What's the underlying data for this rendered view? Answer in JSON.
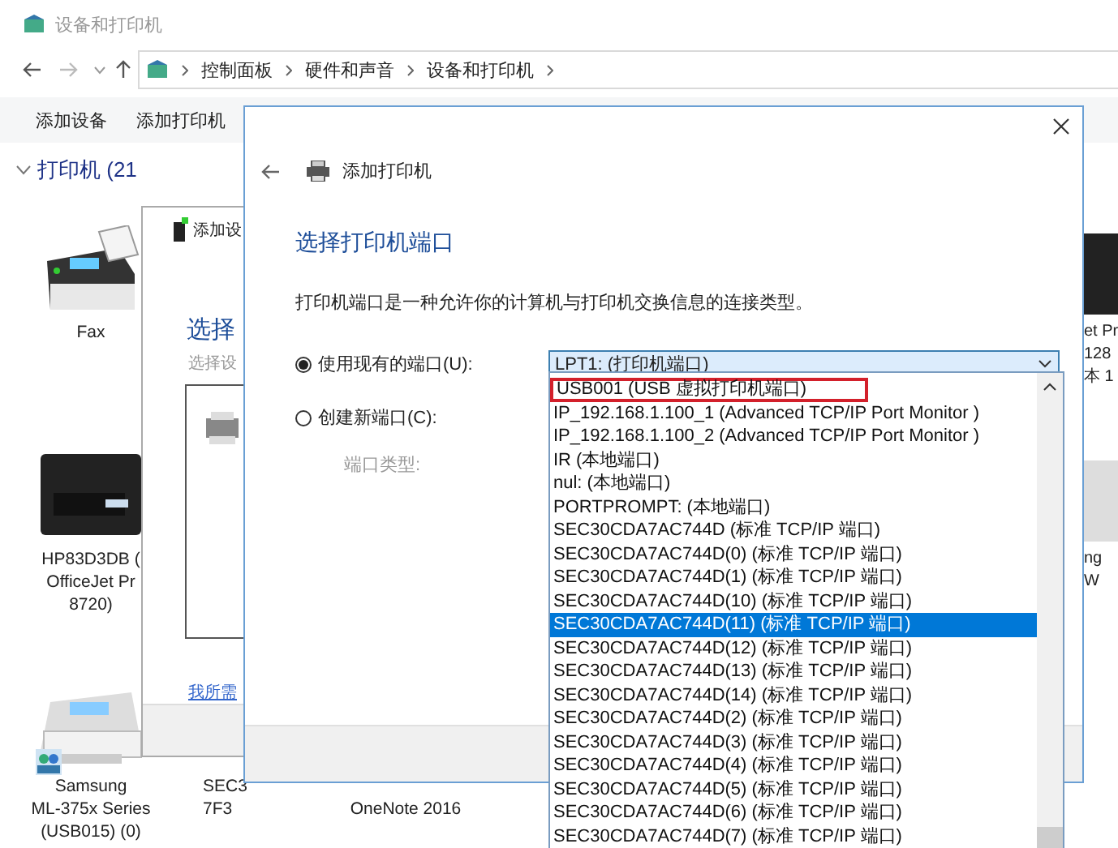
{
  "explorer": {
    "title": "设备和打印机",
    "breadcrumb": [
      "控制面板",
      "硬件和声音",
      "设备和打印机"
    ],
    "toolbar": [
      "添加设备",
      "添加打印机"
    ],
    "group": {
      "label": "打印机 (21",
      "expanded": true
    },
    "devices": [
      {
        "kind": "fax",
        "name_lines": [
          "Fax"
        ],
        "shared": false
      },
      {
        "kind": "mfp",
        "name_lines": [
          "et Pr",
          "128",
          "本 1"
        ],
        "shared": false
      },
      {
        "kind": "mfp",
        "name_lines": [
          "HP83D3DB (",
          "OfficeJet Pr",
          "8720)"
        ],
        "shared": false
      },
      {
        "kind": "laser",
        "name_lines": [
          "ng",
          "W"
        ],
        "shared": false
      },
      {
        "kind": "laser",
        "name_lines": [
          "Samsung",
          "ML-375x Series",
          "(USB015) (0)"
        ],
        "shared": true
      },
      {
        "kind": "none",
        "name_lines": [
          "SEC3",
          "7F3"
        ],
        "shared": false
      },
      {
        "kind": "none",
        "name_lines": [
          "OneNote 2016"
        ],
        "shared": false
      }
    ]
  },
  "device_dialog": {
    "title": "添加设",
    "heading": "选择",
    "subtitle": "选择设",
    "link": "我所需"
  },
  "port_dialog": {
    "title": "添加打印机",
    "heading": "选择打印机端口",
    "description": "打印机端口是一种允许你的计算机与打印机交换信息的连接类型。",
    "options": [
      {
        "label": "使用现有的端口(U):",
        "selected": true
      },
      {
        "label": "创建新端口(C):",
        "selected": false
      }
    ],
    "port_type_label": "端口类型:",
    "port_combo": {
      "value": "LPT1: (打印机端口)",
      "expanded": true
    },
    "port_list": [
      {
        "label": "USB001 (USB 虚拟打印机端口)",
        "selected": false,
        "highlighted": true
      },
      {
        "label": "IP_192.168.1.100_1 (Advanced TCP/IP Port Monitor )",
        "selected": false,
        "highlighted": false
      },
      {
        "label": "IP_192.168.1.100_2 (Advanced TCP/IP Port Monitor )",
        "selected": false,
        "highlighted": false
      },
      {
        "label": "IR (本地端口)",
        "selected": false,
        "highlighted": false
      },
      {
        "label": "nul: (本地端口)",
        "selected": false,
        "highlighted": false
      },
      {
        "label": "PORTPROMPT: (本地端口)",
        "selected": false,
        "highlighted": false
      },
      {
        "label": "SEC30CDA7AC744D (标准 TCP/IP 端口)",
        "selected": false,
        "highlighted": false
      },
      {
        "label": "SEC30CDA7AC744D(0) (标准 TCP/IP 端口)",
        "selected": false,
        "highlighted": false
      },
      {
        "label": "SEC30CDA7AC744D(1) (标准 TCP/IP 端口)",
        "selected": false,
        "highlighted": false
      },
      {
        "label": "SEC30CDA7AC744D(10) (标准 TCP/IP 端口)",
        "selected": false,
        "highlighted": false
      },
      {
        "label": "SEC30CDA7AC744D(11) (标准 TCP/IP 端口)",
        "selected": true,
        "highlighted": false
      },
      {
        "label": "SEC30CDA7AC744D(12) (标准 TCP/IP 端口)",
        "selected": false,
        "highlighted": false
      },
      {
        "label": "SEC30CDA7AC744D(13) (标准 TCP/IP 端口)",
        "selected": false,
        "highlighted": false
      },
      {
        "label": "SEC30CDA7AC744D(14) (标准 TCP/IP 端口)",
        "selected": false,
        "highlighted": false
      },
      {
        "label": "SEC30CDA7AC744D(2) (标准 TCP/IP 端口)",
        "selected": false,
        "highlighted": false
      },
      {
        "label": "SEC30CDA7AC744D(3) (标准 TCP/IP 端口)",
        "selected": false,
        "highlighted": false
      },
      {
        "label": "SEC30CDA7AC744D(4) (标准 TCP/IP 端口)",
        "selected": false,
        "highlighted": false
      },
      {
        "label": "SEC30CDA7AC744D(5) (标准 TCP/IP 端口)",
        "selected": false,
        "highlighted": false
      },
      {
        "label": "SEC30CDA7AC744D(6) (标准 TCP/IP 端口)",
        "selected": false,
        "highlighted": false
      },
      {
        "label": "SEC30CDA7AC744D(7) (标准 TCP/IP 端口)",
        "selected": false,
        "highlighted": false
      }
    ]
  }
}
